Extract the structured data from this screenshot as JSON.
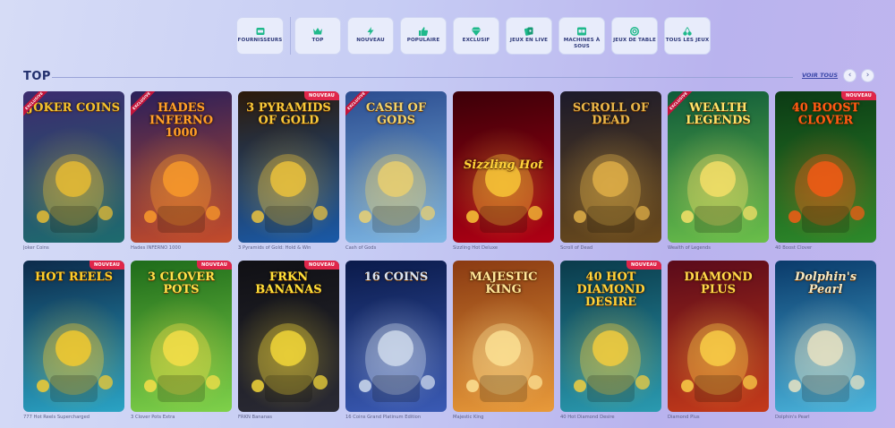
{
  "categories": [
    {
      "label": "Fournisseurs",
      "icon": "provider-icon"
    },
    {
      "label": "Top",
      "icon": "crown-icon"
    },
    {
      "label": "Nouveau",
      "icon": "lightning-icon"
    },
    {
      "label": "Populaire",
      "icon": "thumbs-up-icon"
    },
    {
      "label": "Exclusif",
      "icon": "diamond-icon"
    },
    {
      "label": "Jeux en live",
      "icon": "live-cards-icon"
    },
    {
      "label": "Machines à sous",
      "icon": "slot-machine-icon"
    },
    {
      "label": "Jeux de table",
      "icon": "chip-icon"
    },
    {
      "label": "Tous les jeux",
      "icon": "cherries-icon"
    }
  ],
  "section": {
    "title": "TOP",
    "view_all": "VOIR TOUS",
    "prev": "‹",
    "next": "›"
  },
  "games": [
    {
      "name": "Joker Coins",
      "logo": "JOKER COINS",
      "badge": "",
      "ribbon": "EXCLUSIVE",
      "bg1": "#3b2b6e",
      "bg2": "#1d6b6e",
      "accent": "#f2c230"
    },
    {
      "name": "Hades INFERNO 1000",
      "logo": "HADES INFERNO 1000",
      "badge": "",
      "ribbon": "EXCLUSIVE",
      "bg1": "#2a1f5a",
      "bg2": "#c44b2a",
      "accent": "#ff9f2a"
    },
    {
      "name": "3 Pyramids of Gold: Hold & Win",
      "logo": "3 PYRAMIDS OF GOLD",
      "badge": "NOUVEAU",
      "ribbon": "",
      "bg1": "#2c1a0a",
      "bg2": "#1a5aa8",
      "accent": "#f7c93a"
    },
    {
      "name": "Cash of Gods",
      "logo": "CASH OF GODS",
      "badge": "",
      "ribbon": "EXCLUSIVE",
      "bg1": "#2b4c8f",
      "bg2": "#7db6e3",
      "accent": "#f2d36b"
    },
    {
      "name": "Sizzling Hot Deluxe",
      "logo": "Sizzling Hot",
      "badge": "",
      "ribbon": "",
      "bg1": "#3b0008",
      "bg2": "#b00014",
      "accent": "#ffd23a"
    },
    {
      "name": "Scroll of Dead",
      "logo": "SCROLL OF DEAD",
      "badge": "",
      "ribbon": "",
      "bg1": "#1c1a2a",
      "bg2": "#6a4a1c",
      "accent": "#e8b64a"
    },
    {
      "name": "Wealth of Legends",
      "logo": "WEALTH LEGENDS",
      "badge": "",
      "ribbon": "EXCLUSIVE",
      "bg1": "#0f5a3a",
      "bg2": "#6bbf4a",
      "accent": "#ffe36a"
    },
    {
      "name": "40 Boost Clover",
      "logo": "40 BOOST CLOVER",
      "badge": "NOUVEAU",
      "ribbon": "",
      "bg1": "#0b3a14",
      "bg2": "#2e8a2a",
      "accent": "#ff5a14"
    },
    {
      "name": "777 Hot Reels Supercharged",
      "logo": "HOT REELS",
      "badge": "NOUVEAU",
      "ribbon": "",
      "bg1": "#0c2a4a",
      "bg2": "#2aa3c4",
      "accent": "#ffcf2a"
    },
    {
      "name": "3 Clover Pots Extra",
      "logo": "3 CLOVER POTS",
      "badge": "NOUVEAU",
      "ribbon": "",
      "bg1": "#1e6b1a",
      "bg2": "#7fd14a",
      "accent": "#ffe14a"
    },
    {
      "name": "FRKN Bananas",
      "logo": "FRKN BANANAS",
      "badge": "NOUVEAU",
      "ribbon": "",
      "bg1": "#101014",
      "bg2": "#2a2a34",
      "accent": "#ffe13a"
    },
    {
      "name": "16 Coins Grand Platinum Edition",
      "logo": "16 COINS",
      "badge": "",
      "ribbon": "",
      "bg1": "#0a1a4a",
      "bg2": "#3a5ab4",
      "accent": "#d8e3f2"
    },
    {
      "name": "Majestic King",
      "logo": "MAJESTIC KING",
      "badge": "",
      "ribbon": "",
      "bg1": "#8a3a12",
      "bg2": "#e89a3a",
      "accent": "#ffe79a"
    },
    {
      "name": "40 Hot Diamond Desire",
      "logo": "40 HOT DIAMOND DESIRE",
      "badge": "NOUVEAU",
      "ribbon": "",
      "bg1": "#0a3a4a",
      "bg2": "#2a9ab0",
      "accent": "#ffd23a"
    },
    {
      "name": "Diamond Plus",
      "logo": "DIAMOND PLUS",
      "badge": "",
      "ribbon": "",
      "bg1": "#5a0a1a",
      "bg2": "#c43a1a",
      "accent": "#ffd84a"
    },
    {
      "name": "Dolphin's Pearl",
      "logo": "Dolphin's Pearl",
      "badge": "",
      "ribbon": "",
      "bg1": "#0a3a6a",
      "bg2": "#4ab4dc",
      "accent": "#f2e7c3"
    }
  ]
}
